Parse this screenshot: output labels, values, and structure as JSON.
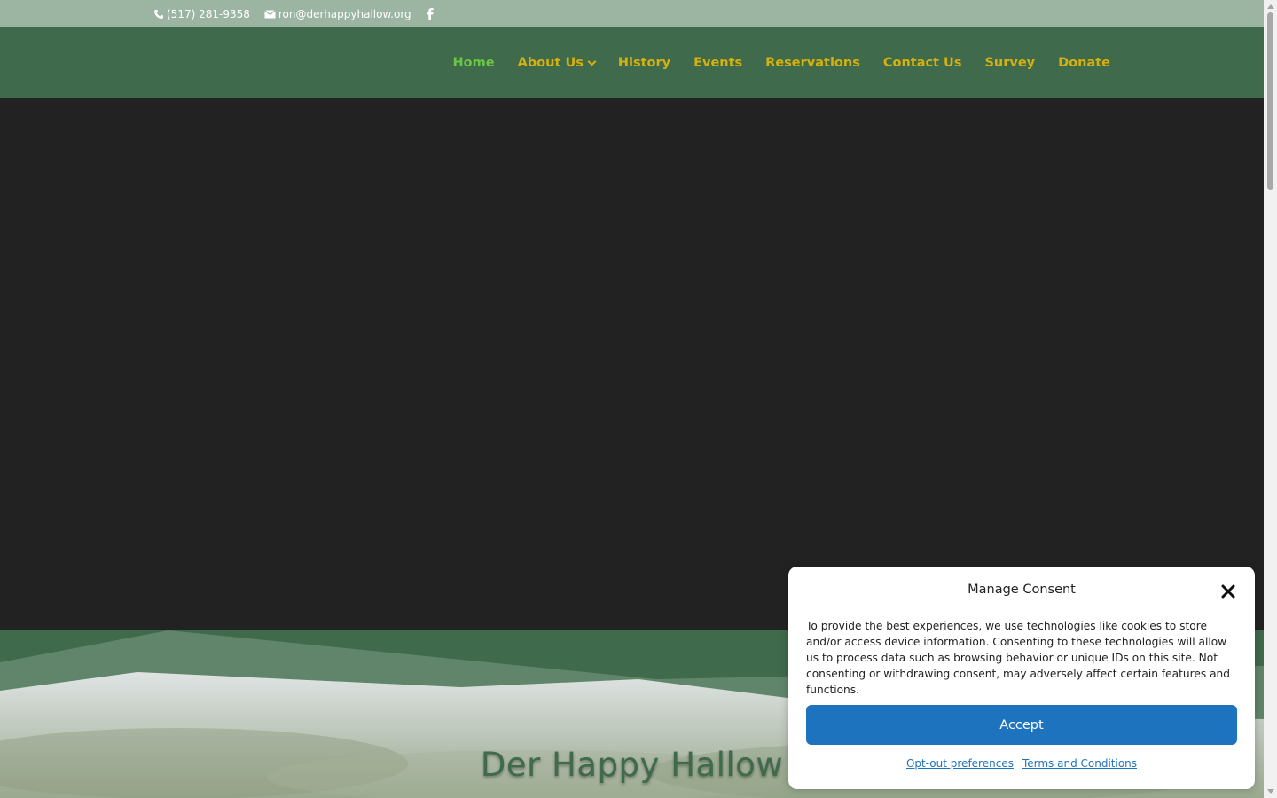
{
  "topbar": {
    "phone": "(517) 281-9358",
    "email": "ron@derhappyhallow.org",
    "icons": [
      "phone-icon",
      "envelope-icon",
      "facebook-icon"
    ]
  },
  "nav": {
    "items": [
      {
        "label": "Home",
        "active": true
      },
      {
        "label": "About Us",
        "has_dropdown": true
      },
      {
        "label": "History"
      },
      {
        "label": "Events"
      },
      {
        "label": "Reservations"
      },
      {
        "label": "Contact Us"
      },
      {
        "label": "Survey"
      },
      {
        "label": "Donate"
      }
    ]
  },
  "hero": {
    "title": "Der Happy Hallow"
  },
  "consent": {
    "title": "Manage Consent",
    "text": "To provide the best experiences, we use technologies like cookies to store and/or access device information. Consenting to these technologies will allow us to process data such as browsing behavior or unique IDs on this site. Not consenting or withdrawing consent, may adversely affect certain features and functions.",
    "accept_label": "Accept",
    "opt_out_label": "Opt-out preferences",
    "terms_label": "Terms and Conditions"
  },
  "colors": {
    "topbar": "#9bb5a2",
    "header": "#3f6a4b",
    "nav_text": "#d4b10f",
    "nav_active": "#6cc644",
    "hero": "#222222",
    "accept_button": "#1e73be"
  }
}
